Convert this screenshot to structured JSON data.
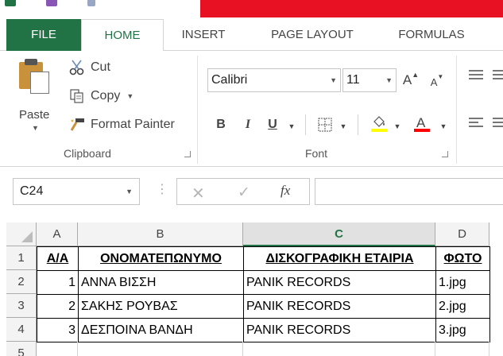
{
  "ribbon": {
    "tabs": [
      "FILE",
      "HOME",
      "INSERT",
      "PAGE LAYOUT",
      "FORMULAS"
    ],
    "active_tab": "HOME",
    "clipboard": {
      "paste": "Paste",
      "cut": "Cut",
      "copy": "Copy",
      "format_painter": "Format Painter",
      "group_label": "Clipboard"
    },
    "font": {
      "font_name": "Calibri",
      "font_size": "11",
      "group_label": "Font",
      "bold": "B",
      "italic": "I",
      "underline": "U",
      "fill_color": "#ffff00",
      "font_color": "#ff0000"
    }
  },
  "formula_bar": {
    "name_box": "C24",
    "fx": "fx",
    "formula": ""
  },
  "sheet": {
    "columns": [
      "A",
      "B",
      "C",
      "D"
    ],
    "selected_column": "C",
    "rows": [
      {
        "num": "1",
        "cells": [
          "Α/Α",
          "ΟΝΟΜΑΤΕΠΩΝΥΜΟ",
          "ΔΙΣΚΟΓΡΑΦΙΚΗ ΕΤΑΙΡΙΑ",
          "ΦΩΤΟ"
        ]
      },
      {
        "num": "2",
        "cells": [
          "1",
          "ΑΝΝΑ ΒΙΣΣΗ",
          "PANIK RECORDS",
          "1.jpg"
        ]
      },
      {
        "num": "3",
        "cells": [
          "2",
          "ΣΑΚΗΣ ΡΟΥΒΑΣ",
          "PANIK RECORDS",
          "2.jpg"
        ]
      },
      {
        "num": "4",
        "cells": [
          "3",
          "ΔΕΣΠΟΙΝΑ ΒΑΝΔΗ",
          "PANIK RECORDS",
          "3.jpg"
        ]
      },
      {
        "num": "5",
        "cells": [
          "",
          "",
          "",
          ""
        ]
      }
    ]
  },
  "colors": {
    "accent": "#217346",
    "title_red": "#e81123"
  }
}
